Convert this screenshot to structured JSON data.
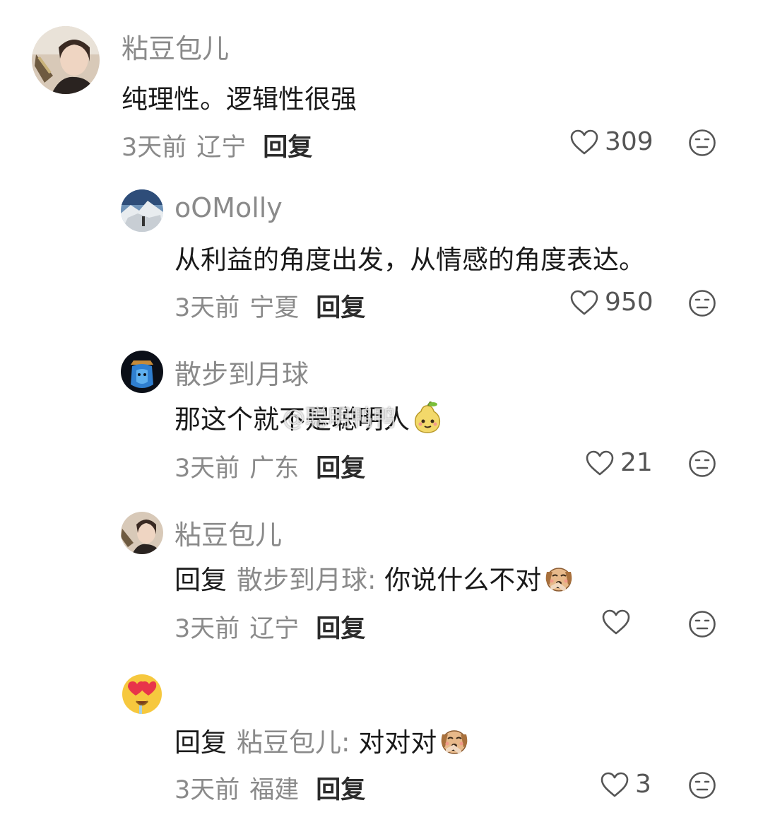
{
  "comments": [
    {
      "username": "粘豆包儿",
      "text": "纯理性。逻辑性很强",
      "time": "3天前",
      "location": "辽宁",
      "reply_label": "回复",
      "likes": "309"
    },
    {
      "username": "oOMolly",
      "text": "从利益的角度出发，从情感的角度表达。",
      "time": "3天前",
      "location": "宁夏",
      "reply_label": "回复",
      "likes": "950"
    },
    {
      "username": "散步到月球",
      "text": "那这个就不是聪明人",
      "time": "3天前",
      "location": "广东",
      "reply_label": "回复",
      "likes": "21"
    },
    {
      "username": "粘豆包儿",
      "reply_keyword": "回复",
      "reply_target": "散步到月球",
      "colon": ":",
      "text": "你说什么不对",
      "time": "3天前",
      "location": "辽宁",
      "reply_label": "回复",
      "likes": ""
    },
    {
      "username": "",
      "reply_keyword": "回复",
      "reply_target": "粘豆包儿",
      "colon": ":",
      "text": "对对对",
      "time": "3天前",
      "location": "福建",
      "reply_label": "回复",
      "likes": "3"
    }
  ],
  "watermark": "@聪明鸭鸭",
  "icons": {
    "like": "heart-outline-icon",
    "dislike": "neutral-face-icon"
  },
  "colors": {
    "primary_text": "#1a1a1a",
    "secondary_text": "#8a8a8a",
    "icon": "#555555"
  }
}
